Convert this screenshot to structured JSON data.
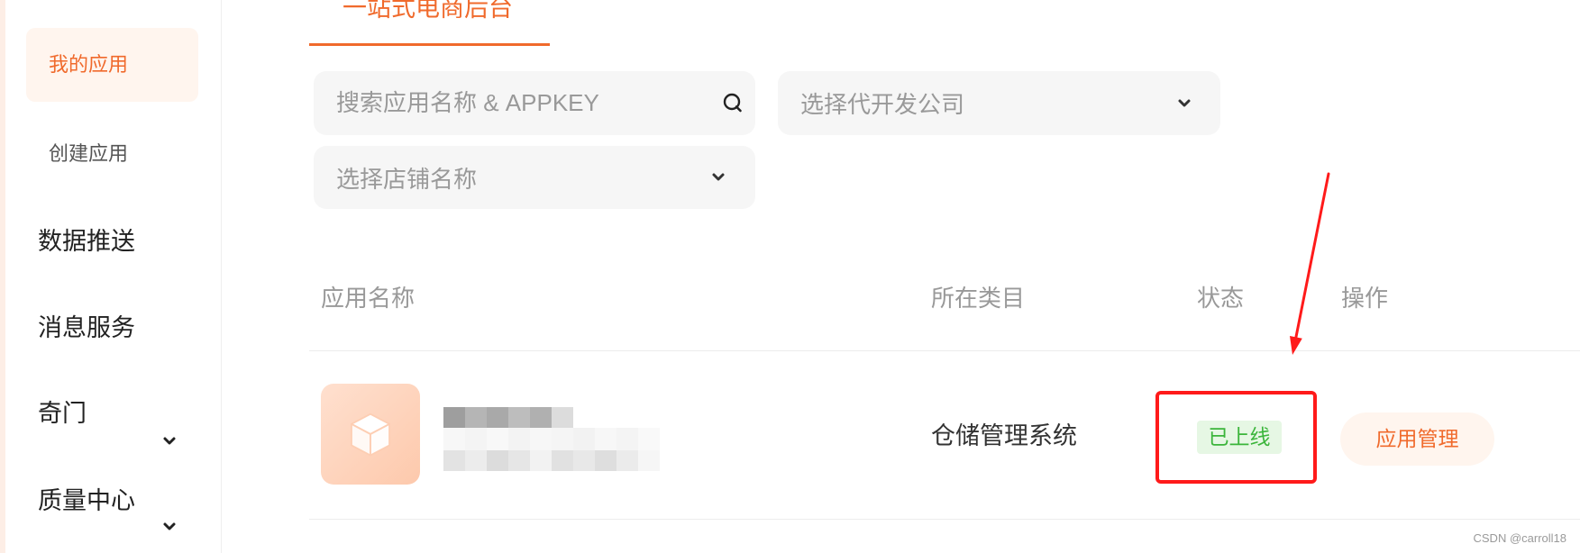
{
  "sidebar": {
    "items": [
      {
        "label": "我的应用",
        "active": true
      },
      {
        "label": "创建应用"
      },
      {
        "label": "数据推送"
      },
      {
        "label": "消息服务"
      },
      {
        "label": "奇门",
        "icon": "chevron-down-icon"
      },
      {
        "label": "质量中心",
        "icon": "chevron-down-icon"
      }
    ]
  },
  "tabs": [
    {
      "label": "一站式电商后台",
      "active": true
    }
  ],
  "filters": {
    "search_placeholder": "搜索应用名称 & APPKEY",
    "search_icon": "search-icon",
    "company_placeholder": "选择代开发公司",
    "shop_placeholder": "选择店铺名称",
    "dropdown_icon": "chevron-down-icon"
  },
  "table": {
    "columns": [
      "应用名称",
      "所在类目",
      "状态",
      "操作"
    ],
    "rows": [
      {
        "icon": "cube-icon",
        "category": "仓储管理系统",
        "status": "已上线",
        "action": "应用管理"
      }
    ]
  },
  "watermark": "CSDN @carroll18",
  "colors": {
    "accent": "#f06a2c",
    "accent_bg": "#fff5ee",
    "success": "#3bb53b",
    "success_bg": "#e6f7e4",
    "annotation": "#ff1a1a"
  }
}
